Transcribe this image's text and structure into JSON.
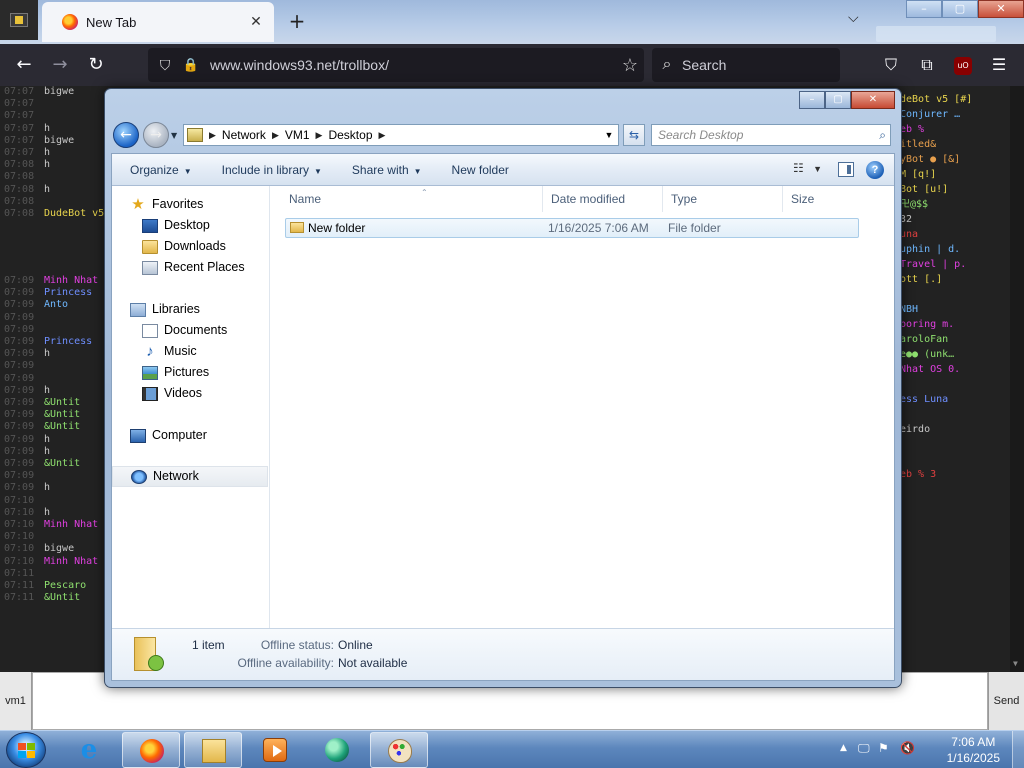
{
  "browser": {
    "tab_title": "New Tab",
    "url_domain": "www.windows93.net",
    "url_path": "/trollbox/",
    "search_placeholder": "Search",
    "ubo_label": "uO"
  },
  "trollbox": {
    "left_lines": [
      {
        "time": "07:07",
        "nick": "bigwe",
        "color": "#c8c8c8"
      },
      {
        "time": "07:07",
        "nick": "",
        "color": "#c8c8c8"
      },
      {
        "time": "07:07",
        "nick": "",
        "color": "#c8c8c8"
      },
      {
        "time": "07:07",
        "nick": "h",
        "color": "#c8c8c8"
      },
      {
        "time": "07:07",
        "nick": "bigwe",
        "color": "#c8c8c8"
      },
      {
        "time": "07:07",
        "nick": "h",
        "color": "#c8c8c8"
      },
      {
        "time": "07:08",
        "nick": "h",
        "color": "#c8c8c8"
      },
      {
        "time": "07:08",
        "nick": "",
        "color": "#c8c8c8"
      },
      {
        "time": "07:08",
        "nick": "h",
        "color": "#c8c8c8"
      },
      {
        "time": "07:08",
        "nick": "",
        "color": "#c8c8c8"
      },
      {
        "time": "07:08",
        "nick": "DudeBot v5",
        "color": "#e8d44d"
      }
    ],
    "left_lines_lower": [
      {
        "time": "07:09",
        "nick": "Minh Nhat",
        "color": "#e040e0"
      },
      {
        "time": "07:09",
        "nick": "Princess",
        "color": "#6f8fff"
      },
      {
        "time": "07:09",
        "nick": "Anto",
        "color": "#6fb8ff"
      },
      {
        "time": "07:09",
        "nick": "",
        "color": "#c8c8c8"
      },
      {
        "time": "07:09",
        "nick": "",
        "color": "#c8c8c8"
      },
      {
        "time": "07:09",
        "nick": "Princess",
        "color": "#6f8fff"
      },
      {
        "time": "07:09",
        "nick": "h",
        "color": "#c8c8c8"
      },
      {
        "time": "07:09",
        "nick": "",
        "color": "#c8c8c8"
      },
      {
        "time": "07:09",
        "nick": "",
        "color": "#c8c8c8"
      },
      {
        "time": "07:09",
        "nick": "h",
        "color": "#c8c8c8"
      },
      {
        "time": "07:09",
        "nick": "&Untit",
        "color": "#8fe06f"
      },
      {
        "time": "07:09",
        "nick": "&Untit",
        "color": "#8fe06f"
      },
      {
        "time": "07:09",
        "nick": "&Untit",
        "color": "#8fe06f"
      },
      {
        "time": "07:09",
        "nick": "h",
        "color": "#c8c8c8"
      },
      {
        "time": "07:09",
        "nick": "h",
        "color": "#c8c8c8"
      },
      {
        "time": "07:09",
        "nick": "&Untit",
        "color": "#8fe06f"
      },
      {
        "time": "07:09",
        "nick": "",
        "color": "#c8c8c8"
      },
      {
        "time": "07:09",
        "nick": "h",
        "color": "#c8c8c8"
      },
      {
        "time": "07:10",
        "nick": "",
        "color": "#c8c8c8"
      },
      {
        "time": "07:10",
        "nick": "h",
        "color": "#c8c8c8"
      },
      {
        "time": "07:10",
        "nick": "Minh Nhat",
        "color": "#e040e0"
      },
      {
        "time": "07:10",
        "nick": "",
        "color": "#c8c8c8"
      },
      {
        "time": "07:10",
        "nick": "bigwe",
        "color": "#c8c8c8"
      },
      {
        "time": "07:10",
        "nick": "Minh Nhat",
        "color": "#e040e0"
      },
      {
        "time": "07:11",
        "nick": "",
        "color": "#c8c8c8"
      },
      {
        "time": "07:11",
        "nick": "Pescaro",
        "color": "#8fe06f"
      },
      {
        "time": "07:11",
        "nick": "&Untit",
        "color": "#8fe06f"
      }
    ],
    "right_lines": [
      {
        "text": "deBot v5 [#]",
        "color": "#e8d44d"
      },
      {
        "text": " Conjurer …",
        "color": "#6fb8ff"
      },
      {
        "text": "eb %",
        "color": "#e040e0"
      },
      {
        "text": "itled&",
        "color": "#e8a04d"
      },
      {
        "text": "yBot ● [&]",
        "color": "#e8a04d"
      },
      {
        "text": "M [q!]",
        "color": "#e8d44d"
      },
      {
        "text": "Bot [u!]",
        "color": "#e8d44d"
      },
      {
        "text": "卍@$$",
        "color": "#8fe06f"
      },
      {
        "text": "32",
        "color": "#c8c8c8"
      },
      {
        "text": "una",
        "color": "#e04040"
      },
      {
        "text": "uphin | d.",
        "color": "#6fb8ff"
      },
      {
        "text": "Travel | p.",
        "color": "#e040e0"
      },
      {
        "text": "ott [.]",
        "color": "#e8d44d"
      },
      {
        "text": "",
        "color": "#c8c8c8"
      },
      {
        "text": "NBH",
        "color": "#6fb8ff"
      },
      {
        "text": " boring m.",
        "color": "#e040e0"
      },
      {
        "text": "aroloFan",
        "color": "#8fe06f"
      },
      {
        "text": "e●● (unk…",
        "color": "#8fe06f"
      },
      {
        "text": " Nhat OS 0.",
        "color": "#e040e0"
      },
      {
        "text": "",
        "color": "#c8c8c8"
      },
      {
        "text": "ess Luna",
        "color": "#6f8fff"
      },
      {
        "text": "",
        "color": "#c8c8c8"
      },
      {
        "text": "eirdo",
        "color": "#c8c8c8"
      },
      {
        "text": "",
        "color": "#c8c8c8"
      },
      {
        "text": "",
        "color": "#c8c8c8"
      },
      {
        "text": "eb % 3",
        "color": "#e04040"
      }
    ],
    "chat_nick": "vm1",
    "send_label": "Send"
  },
  "explorer": {
    "breadcrumb": [
      "Network",
      "VM1",
      "Desktop"
    ],
    "search_placeholder": "Search Desktop",
    "toolbar": {
      "organize": "Organize",
      "include_library": "Include in library",
      "share_with": "Share with",
      "new_folder": "New folder"
    },
    "nav": {
      "favorites": "Favorites",
      "desktop": "Desktop",
      "downloads": "Downloads",
      "recent_places": "Recent Places",
      "libraries": "Libraries",
      "documents": "Documents",
      "music": "Music",
      "pictures": "Pictures",
      "videos": "Videos",
      "computer": "Computer",
      "network": "Network"
    },
    "columns": {
      "name": "Name",
      "date": "Date modified",
      "type": "Type",
      "size": "Size"
    },
    "files": [
      {
        "name": "New folder",
        "date": "1/16/2025 7:06 AM",
        "type": "File folder"
      }
    ],
    "details": {
      "count": "1 item",
      "offline_status_label": "Offline status:",
      "offline_status_value": "Online",
      "offline_availability_label": "Offline availability:",
      "offline_availability_value": "Not available"
    }
  },
  "taskbar": {
    "time": "7:06 AM",
    "date": "1/16/2025"
  }
}
